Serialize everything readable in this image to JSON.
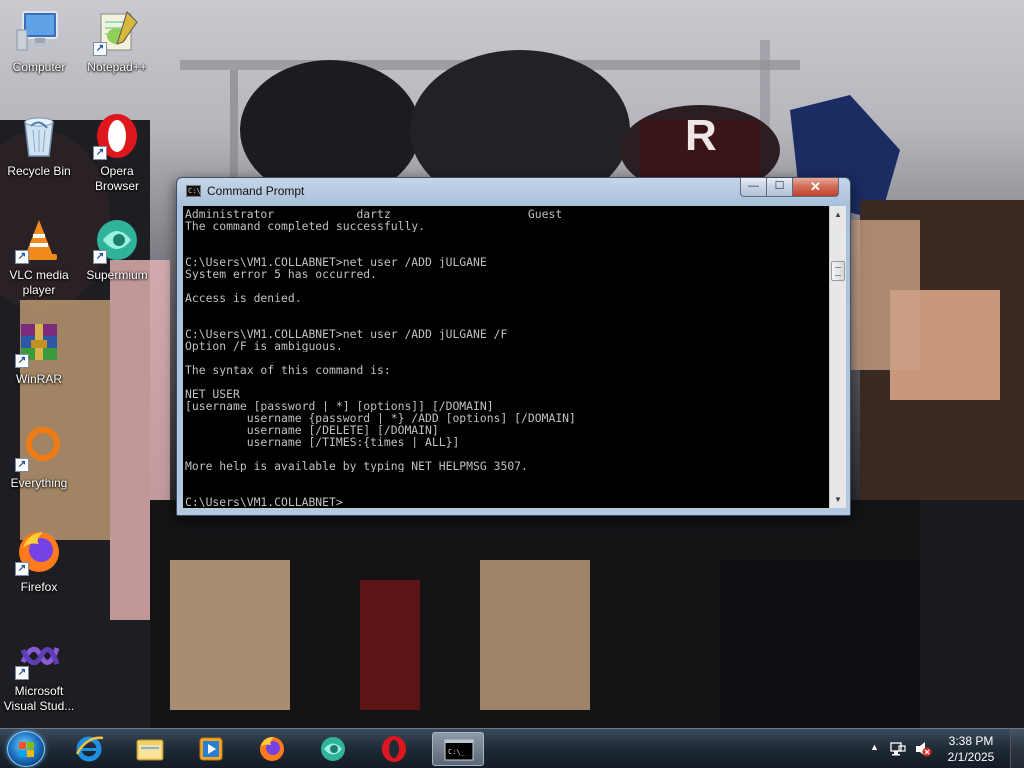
{
  "desktop": {
    "icons": [
      {
        "label": "Computer",
        "icon": "computer-icon"
      },
      {
        "label": "Notepad++",
        "icon": "notepadpp-icon"
      },
      {
        "label": "Recycle Bin",
        "icon": "recycle-bin-icon"
      },
      {
        "label": "Opera Browser",
        "icon": "opera-icon"
      },
      {
        "label": "VLC media player",
        "icon": "vlc-icon"
      },
      {
        "label": "Supermium",
        "icon": "supermium-icon"
      },
      {
        "label": "WinRAR",
        "icon": "winrar-icon"
      },
      {
        "label": "Everything",
        "icon": "everything-icon"
      },
      {
        "label": "Firefox",
        "icon": "firefox-icon"
      },
      {
        "label": "Microsoft Visual Stud...",
        "icon": "visual-studio-icon"
      }
    ]
  },
  "cmd_window": {
    "title": "Command Prompt",
    "icon_text": "C:\\_",
    "buttons": {
      "minimize": "—",
      "maximize": "☐",
      "close": "✕"
    },
    "console_lines": [
      "Administrator            dartz                    Guest",
      "The command completed successfully.",
      "",
      "",
      "C:\\Users\\VM1.COLLABNET>net user /ADD jULGANE",
      "System error 5 has occurred.",
      "",
      "Access is denied.",
      "",
      "",
      "C:\\Users\\VM1.COLLABNET>net user /ADD jULGANE /F",
      "Option /F is ambiguous.",
      "",
      "The syntax of this command is:",
      "",
      "NET USER",
      "[username [password | *] [options]] [/DOMAIN]",
      "         username {password | *} /ADD [options] [/DOMAIN]",
      "         username [/DELETE] [/DOMAIN]",
      "         username [/TIMES:{times | ALL}]",
      "",
      "More help is available by typing NET HELPMSG 3507.",
      "",
      "",
      "C:\\Users\\VM1.COLLABNET>"
    ],
    "scroll_position": 0.15
  },
  "taskbar": {
    "pinned": [
      {
        "name": "internet-explorer",
        "icon": "ie-icon"
      },
      {
        "name": "file-explorer",
        "icon": "folder-icon"
      },
      {
        "name": "media-player",
        "icon": "media-player-icon"
      },
      {
        "name": "firefox",
        "icon": "firefox-icon"
      },
      {
        "name": "supermium",
        "icon": "supermium-icon"
      },
      {
        "name": "opera",
        "icon": "opera-icon"
      },
      {
        "name": "command-prompt",
        "icon": "cmd-icon",
        "active": true
      }
    ],
    "cmd_icon_text": "C:\\_",
    "tray": {
      "show_hidden": "▲",
      "time": "3:38 PM",
      "date": "2/1/2025"
    }
  },
  "colors": {
    "console_bg": "#000000",
    "console_fg": "#c0c0c0",
    "taskbar": "#1f2a36",
    "close_button": "#c2412a"
  }
}
